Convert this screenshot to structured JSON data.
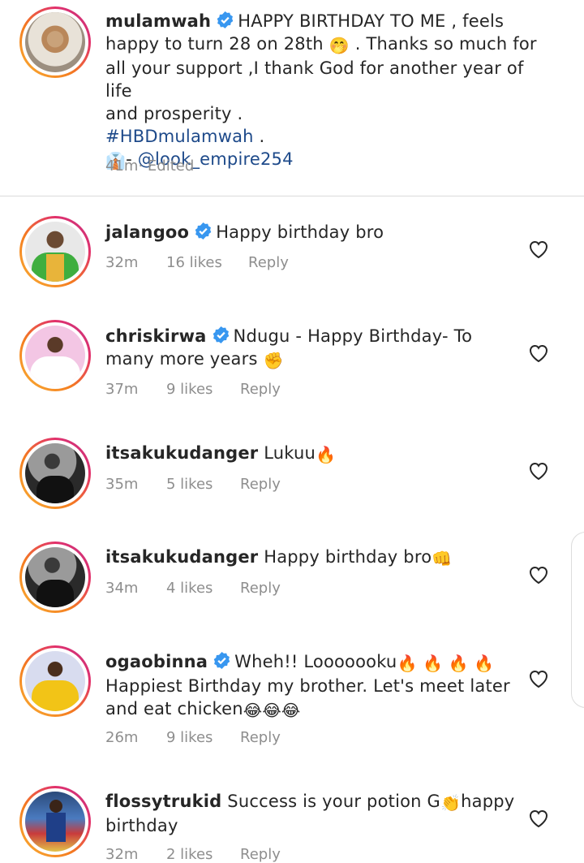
{
  "caption": {
    "username": "mulamwah",
    "text_line1": "HAPPY BIRTHDAY TO ME , feels",
    "text_line2a": "happy to turn 28 on 28th",
    "emoji_hush": "🤭",
    "text_line2b": ". Thanks so much for",
    "text_line3": "all your support ,I thank God for another year of life",
    "text_line4": "and prosperity .",
    "hashtag": "#HBDmulamwah",
    "hashtag_suffix": " .",
    "credit_emoji": "👔",
    "credit_dash": "- ",
    "mention": "@look_empire254",
    "time": "41m",
    "edited": " · Edited"
  },
  "comments": [
    {
      "username": "jalangoo",
      "verified": true,
      "text": "Happy birthday bro",
      "time": "32m",
      "likes": "16 likes",
      "reply": "Reply"
    },
    {
      "username": "chriskirwa",
      "verified": true,
      "text": "Ndugu - Happy Birthday- To",
      "text2": "many more years",
      "emoji": "✊",
      "time": "37m",
      "likes": "9 likes",
      "reply": "Reply"
    },
    {
      "username": "itsakukudanger",
      "verified": false,
      "text": "Lukuu",
      "emoji": "🔥",
      "time": "35m",
      "likes": "5 likes",
      "reply": "Reply"
    },
    {
      "username": "itsakukudanger",
      "verified": false,
      "text": "Happy birthday bro",
      "emoji": "👊",
      "time": "34m",
      "likes": "4 likes",
      "reply": "Reply"
    },
    {
      "username": "ogaobinna",
      "verified": true,
      "text": "Wheh!! Looooooku",
      "emoji": "🔥 🔥 🔥 🔥",
      "text2": "Happiest Birthday my brother. Let's meet later",
      "text3": "and eat chicken",
      "emoji2": "😂😂😂",
      "time": "26m",
      "likes": "9 likes",
      "reply": "Reply"
    },
    {
      "username": "flossytrukid",
      "verified": false,
      "text": "Success is your potion G",
      "emoji": "👏",
      "text_after": "happy",
      "text2": "birthday",
      "time": "32m",
      "likes": "2 likes",
      "reply": "Reply"
    }
  ],
  "colors": {
    "verified": "#3897f0",
    "link": "#1e4a8a",
    "meta": "#8e8e8e"
  }
}
